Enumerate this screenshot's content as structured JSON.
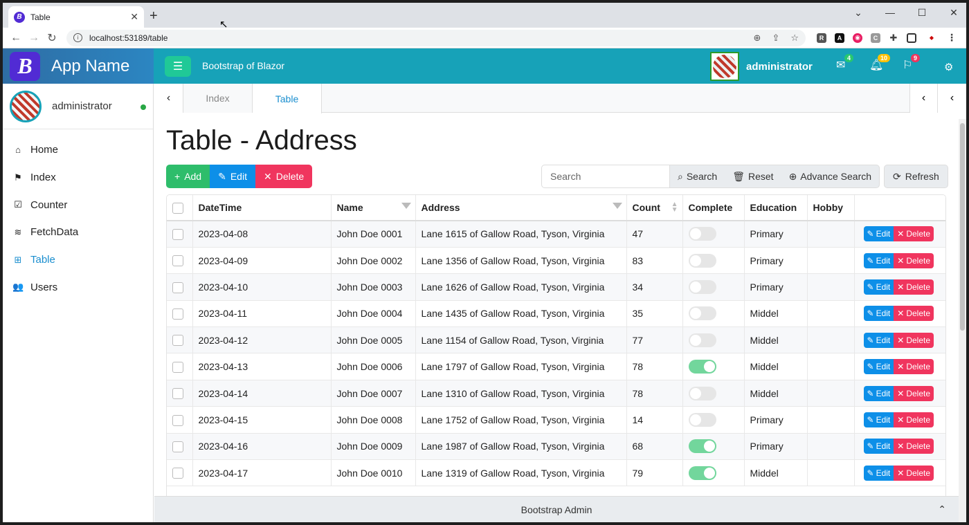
{
  "browser": {
    "tab_title": "Table",
    "url": "localhost:53189/table"
  },
  "header": {
    "app_name": "App Name",
    "logo_letter": "B",
    "title": "Bootstrap of Blazor",
    "username": "administrator",
    "badges": {
      "mail": "4",
      "bell": "10",
      "flag": "9"
    }
  },
  "sidebar": {
    "username": "administrator",
    "items": [
      {
        "label": "Home",
        "icon": "home-icon",
        "glyph": "⌂"
      },
      {
        "label": "Index",
        "icon": "flag-icon",
        "glyph": "⚑"
      },
      {
        "label": "Counter",
        "icon": "check-square-icon",
        "glyph": "☑"
      },
      {
        "label": "FetchData",
        "icon": "database-icon",
        "glyph": "≋"
      },
      {
        "label": "Table",
        "icon": "table-icon",
        "glyph": "⊞"
      },
      {
        "label": "Users",
        "icon": "users-icon",
        "glyph": "👥"
      }
    ]
  },
  "tabs": [
    {
      "label": "Index"
    },
    {
      "label": "Table"
    }
  ],
  "page": {
    "title": "Table - Address",
    "add": "Add",
    "edit": "Edit",
    "delete": "Delete",
    "search_placeholder": "Search",
    "search": "Search",
    "reset": "Reset",
    "advance_search": "Advance Search",
    "refresh": "Refresh"
  },
  "table": {
    "columns": [
      "DateTime",
      "Name",
      "Address",
      "Count",
      "Complete",
      "Education",
      "Hobby"
    ],
    "edit_label": "Edit",
    "delete_label": "Delete",
    "rows": [
      {
        "date": "2023-04-08",
        "name": "John Doe 0001",
        "address": "Lane 1615 of Gallow Road, Tyson, Virginia",
        "count": "47",
        "complete": false,
        "education": "Primary",
        "hobby": ""
      },
      {
        "date": "2023-04-09",
        "name": "John Doe 0002",
        "address": "Lane 1356 of Gallow Road, Tyson, Virginia",
        "count": "83",
        "complete": false,
        "education": "Primary",
        "hobby": ""
      },
      {
        "date": "2023-04-10",
        "name": "John Doe 0003",
        "address": "Lane 1626 of Gallow Road, Tyson, Virginia",
        "count": "34",
        "complete": false,
        "education": "Primary",
        "hobby": ""
      },
      {
        "date": "2023-04-11",
        "name": "John Doe 0004",
        "address": "Lane 1435 of Gallow Road, Tyson, Virginia",
        "count": "35",
        "complete": false,
        "education": "Middel",
        "hobby": ""
      },
      {
        "date": "2023-04-12",
        "name": "John Doe 0005",
        "address": "Lane 1154 of Gallow Road, Tyson, Virginia",
        "count": "77",
        "complete": false,
        "education": "Middel",
        "hobby": ""
      },
      {
        "date": "2023-04-13",
        "name": "John Doe 0006",
        "address": "Lane 1797 of Gallow Road, Tyson, Virginia",
        "count": "78",
        "complete": true,
        "education": "Middel",
        "hobby": ""
      },
      {
        "date": "2023-04-14",
        "name": "John Doe 0007",
        "address": "Lane 1310 of Gallow Road, Tyson, Virginia",
        "count": "78",
        "complete": false,
        "education": "Middel",
        "hobby": ""
      },
      {
        "date": "2023-04-15",
        "name": "John Doe 0008",
        "address": "Lane 1752 of Gallow Road, Tyson, Virginia",
        "count": "14",
        "complete": false,
        "education": "Primary",
        "hobby": ""
      },
      {
        "date": "2023-04-16",
        "name": "John Doe 0009",
        "address": "Lane 1987 of Gallow Road, Tyson, Virginia",
        "count": "68",
        "complete": true,
        "education": "Primary",
        "hobby": ""
      },
      {
        "date": "2023-04-17",
        "name": "John Doe 0010",
        "address": "Lane 1319 of Gallow Road, Tyson, Virginia",
        "count": "79",
        "complete": true,
        "education": "Middel",
        "hobby": ""
      }
    ]
  },
  "footer": {
    "text": "Bootstrap Admin"
  },
  "colors": {
    "header": "#17a2b8",
    "accent": "#1a8ecf",
    "success": "#2ebd6b",
    "danger": "#f0355e"
  }
}
